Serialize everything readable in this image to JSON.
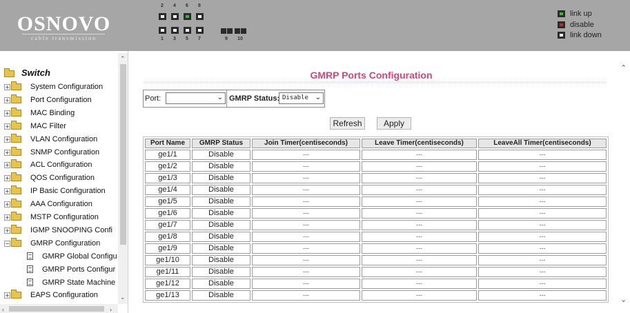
{
  "header": {
    "brand": "OSNOVO",
    "tagline": "cable transmission",
    "port_numbers_top": [
      "2",
      "4",
      "6",
      "8"
    ],
    "port_numbers_bottom": [
      "1",
      "3",
      "5",
      "7"
    ],
    "fiber_port_numbers": [
      "9",
      "10"
    ],
    "port_states_top": [
      "link-down",
      "link-down",
      "link-up",
      "link-down"
    ],
    "port_states_bottom": [
      "link-down",
      "link-down",
      "link-down",
      "link-down"
    ],
    "legend": [
      {
        "label": "link up",
        "color": "#2ec41d"
      },
      {
        "label": "disable",
        "color": "#e01d1d"
      },
      {
        "label": "link down",
        "color": "#ffffff"
      }
    ]
  },
  "sidebar": {
    "root_label": "Switch",
    "items": [
      {
        "label": "System Configuration",
        "expanded": false
      },
      {
        "label": "Port Configuration",
        "expanded": false
      },
      {
        "label": "MAC Binding",
        "expanded": false
      },
      {
        "label": "MAC Filter",
        "expanded": false
      },
      {
        "label": "VLAN Configuration",
        "expanded": false
      },
      {
        "label": "SNMP Configuration",
        "expanded": false
      },
      {
        "label": "ACL Configuration",
        "expanded": false
      },
      {
        "label": "QOS Configuration",
        "expanded": false
      },
      {
        "label": "IP Basic Configuration",
        "expanded": false
      },
      {
        "label": "AAA Configuration",
        "expanded": false
      },
      {
        "label": "MSTP Configuration",
        "expanded": false
      },
      {
        "label": "IGMP SNOOPING Confi",
        "expanded": false
      },
      {
        "label": "GMRP Configuration",
        "expanded": true
      },
      {
        "label": "GMRP Global Configu",
        "leaf": true
      },
      {
        "label": "GMRP Ports Configur",
        "leaf": true
      },
      {
        "label": "GMRP State Machine",
        "leaf": true
      },
      {
        "label": "EAPS Configuration",
        "expanded": false
      }
    ]
  },
  "main": {
    "title": "GMRP Ports Configuration",
    "port_filter_label": "Port:",
    "port_filter_value": "",
    "status_filter_label": "GMRP Status:",
    "status_filter_value": "Disable",
    "refresh_label": "Refresh",
    "apply_label": "Apply",
    "table": {
      "columns": [
        "Port Name",
        "GMRP Status",
        "Join Timer(centiseconds)",
        "Leave Timer(centiseconds)",
        "LeaveAll Timer(centiseconds)"
      ],
      "rows": [
        [
          "ge1/1",
          "Disable",
          "---",
          "---",
          "---"
        ],
        [
          "ge1/2",
          "Disable",
          "---",
          "---",
          "---"
        ],
        [
          "ge1/3",
          "Disable",
          "---",
          "---",
          "---"
        ],
        [
          "ge1/4",
          "Disable",
          "---",
          "---",
          "---"
        ],
        [
          "ge1/5",
          "Disable",
          "---",
          "---",
          "---"
        ],
        [
          "ge1/6",
          "Disable",
          "---",
          "---",
          "---"
        ],
        [
          "ge1/7",
          "Disable",
          "---",
          "---",
          "---"
        ],
        [
          "ge1/8",
          "Disable",
          "---",
          "---",
          "---"
        ],
        [
          "ge1/9",
          "Disable",
          "---",
          "---",
          "---"
        ],
        [
          "ge1/10",
          "Disable",
          "---",
          "---",
          "---"
        ],
        [
          "ge1/11",
          "Disable",
          "---",
          "---",
          "---"
        ],
        [
          "ge1/12",
          "Disable",
          "---",
          "---",
          "---"
        ],
        [
          "ge1/13",
          "Disable",
          "---",
          "---",
          "---"
        ]
      ]
    }
  }
}
